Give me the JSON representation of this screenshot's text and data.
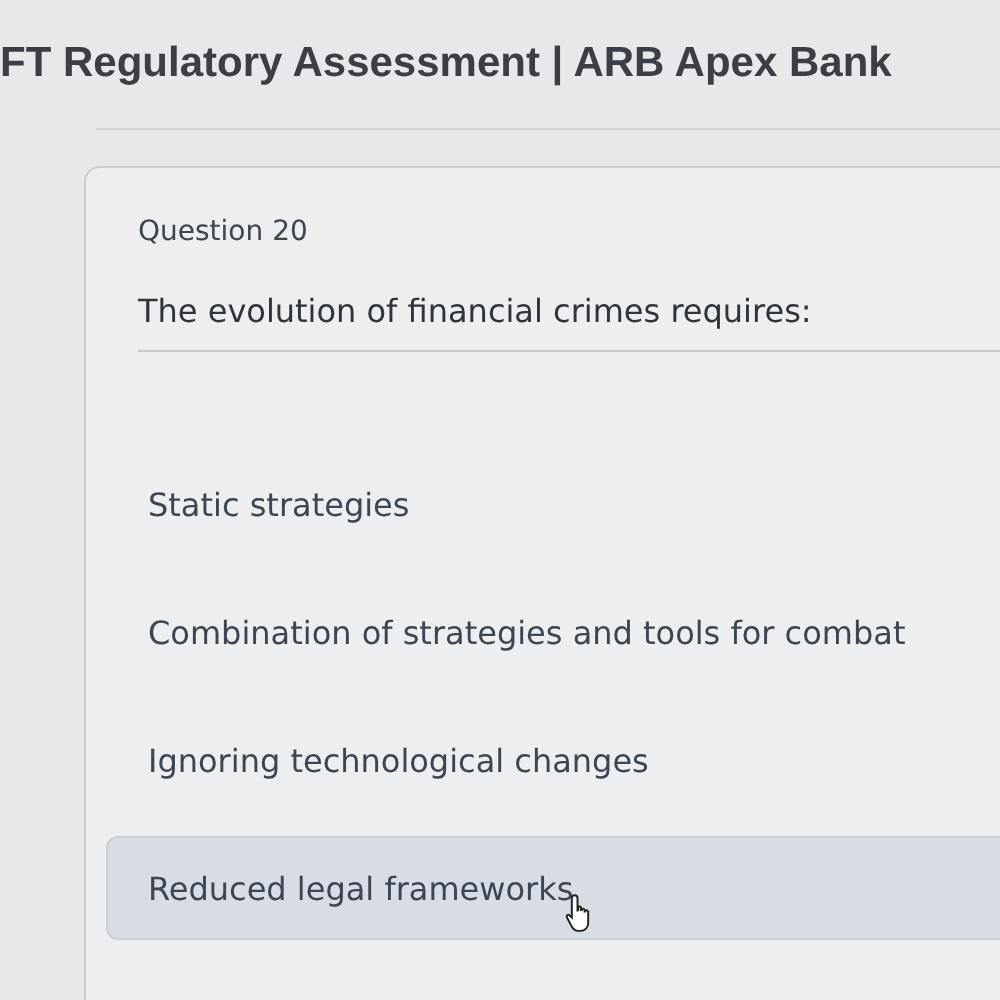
{
  "header": {
    "title": "FT Regulatory Assessment | ARB Apex Bank"
  },
  "question": {
    "number": "Question 20",
    "text": "The evolution of financial crimes requires:"
  },
  "options": [
    {
      "label": "Static strategies",
      "selected": false
    },
    {
      "label": "Combination of strategies and tools for combat",
      "selected": false
    },
    {
      "label": "Ignoring technological changes",
      "selected": false
    },
    {
      "label": "Reduced legal frameworks",
      "selected": true
    }
  ]
}
